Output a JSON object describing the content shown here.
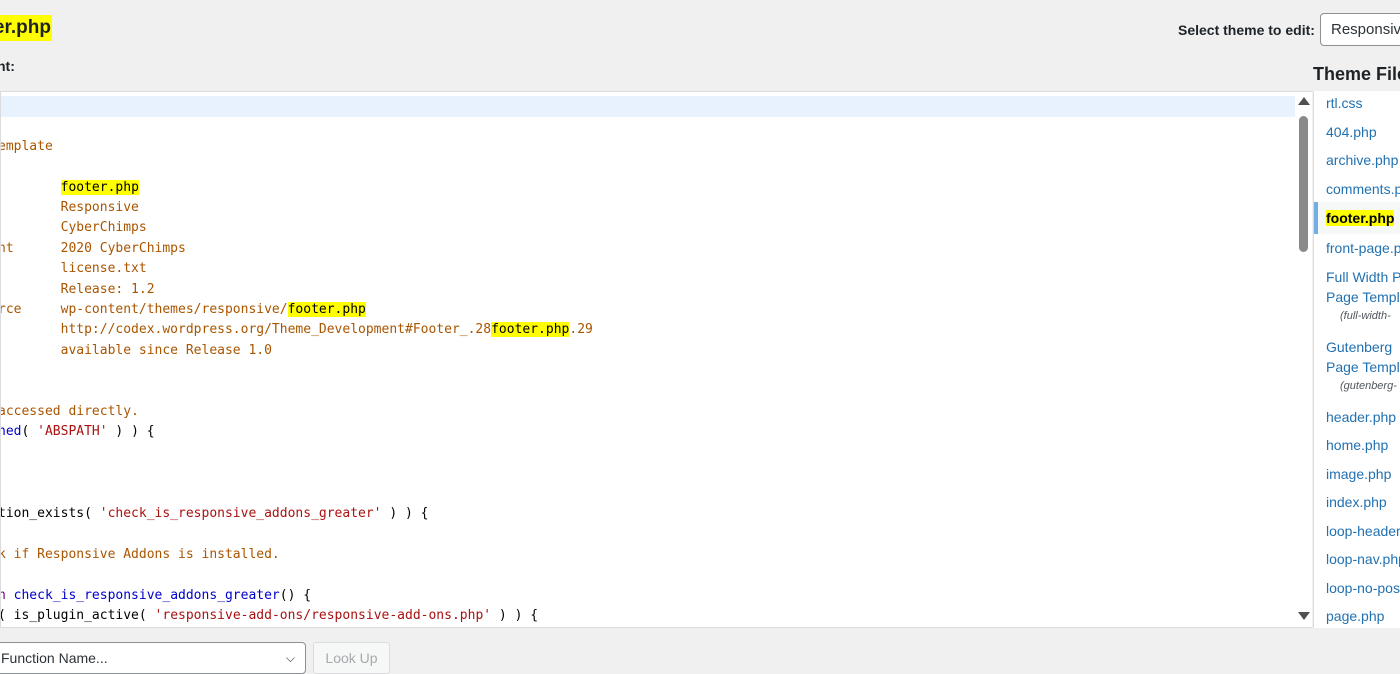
{
  "header": {
    "file_title": "oter.php",
    "content_label": "nt:",
    "select_theme_label": "Select theme to edit:",
    "selected_theme": "Responsive"
  },
  "editor": {
    "lines": [
      [],
      [],
      [
        {
          "t": "emplate",
          "c": "comment"
        }
      ],
      [],
      [
        {
          "t": "        ",
          "c": ""
        },
        {
          "t": "footer.php",
          "c": "hl"
        }
      ],
      [
        {
          "t": "        Responsive",
          "c": "comment"
        }
      ],
      [
        {
          "t": "        CyberChimps",
          "c": "comment"
        }
      ],
      [
        {
          "t": "ht      2020 CyberChimps",
          "c": "comment"
        }
      ],
      [
        {
          "t": "        license.txt",
          "c": "comment"
        }
      ],
      [
        {
          "t": "        Release: 1.2",
          "c": "comment"
        }
      ],
      [
        {
          "t": "rce     wp-content/themes/responsive/",
          "c": "comment"
        },
        {
          "t": "footer.php",
          "c": "hl"
        }
      ],
      [
        {
          "t": "        http://codex.wordpress.org/Theme_Development#Footer_.28",
          "c": "comment"
        },
        {
          "t": "footer.php",
          "c": "hl"
        },
        {
          "t": ".29",
          "c": "comment"
        }
      ],
      [
        {
          "t": "        available since Release 1.0",
          "c": "comment"
        }
      ],
      [],
      [],
      [
        {
          "t": "accessed directly.",
          "c": "comment"
        }
      ],
      [
        {
          "t": "ned",
          "c": "func"
        },
        {
          "t": "( ",
          "c": ""
        },
        {
          "t": "'ABSPATH'",
          "c": "string"
        },
        {
          "t": " ) ) {",
          "c": ""
        }
      ],
      [],
      [],
      [],
      [
        {
          "t": "tion_exists( ",
          "c": ""
        },
        {
          "t": "'check_is_responsive_addons_greater'",
          "c": "string"
        },
        {
          "t": " ) ) {",
          "c": ""
        }
      ],
      [],
      [
        {
          "t": "k if Responsive Addons is installed.",
          "c": "comment"
        }
      ],
      [],
      [
        {
          "t": "n ",
          "c": "kw"
        },
        {
          "t": "check_is_responsive_addons_greater",
          "c": "func"
        },
        {
          "t": "() {",
          "c": ""
        }
      ],
      [
        {
          "t": "( is_plugin_active( ",
          "c": ""
        },
        {
          "t": "'responsive-add-ons/responsive-add-ons.php'",
          "c": "string"
        },
        {
          "t": " ) ) {",
          "c": ""
        }
      ]
    ]
  },
  "files": {
    "heading": "Theme Files",
    "items": [
      {
        "label": "rtl.css"
      },
      {
        "label": "404.php"
      },
      {
        "label": "archive.php"
      },
      {
        "label": "comments.php"
      },
      {
        "label": "footer.php",
        "active": true
      },
      {
        "label": "front-page.php"
      },
      {
        "label": "Full Width Page Template",
        "l1": "Full Width P",
        "l2": "Page Templ",
        "sub": "(full-width-"
      },
      {
        "label": "Gutenberg Page Template",
        "l1": "Gutenberg",
        "l2": "Page Templ",
        "sub": "(gutenberg-"
      },
      {
        "label": "header.php"
      },
      {
        "label": "home.php"
      },
      {
        "label": "image.php"
      },
      {
        "label": "index.php"
      },
      {
        "label": "loop-header.php"
      },
      {
        "label": "loop-nav.php"
      },
      {
        "label": "loop-no-posts.php"
      },
      {
        "label": "page.php"
      }
    ]
  },
  "footer": {
    "docs_placeholder": "Function Name...",
    "lookup_label": "Look Up"
  }
}
